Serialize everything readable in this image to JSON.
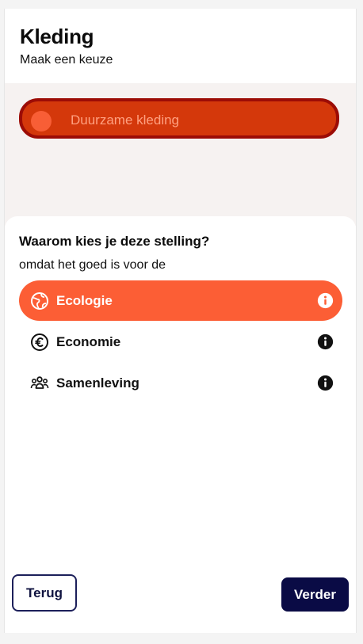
{
  "header": {
    "title": "Kleding",
    "subtitle": "Maak een keuze"
  },
  "statement": {
    "label": "Duurzame kleding",
    "colors": {
      "fill": "#d4380b",
      "border": "#9c0c06",
      "dot": "#f85e36"
    }
  },
  "reason": {
    "question": "Waarom kies je deze stelling?",
    "lead": "omdat het goed is voor de",
    "options": [
      {
        "label": "Ecologie",
        "icon": "globe-icon",
        "selected": true
      },
      {
        "label": "Economie",
        "icon": "euro-icon",
        "selected": false
      },
      {
        "label": "Samenleving",
        "icon": "people-icon",
        "selected": false
      }
    ]
  },
  "footer": {
    "back_label": "Terug",
    "next_label": "Verder"
  },
  "colors": {
    "accent": "#fc5e35",
    "primary_dark": "#0a0b45"
  }
}
